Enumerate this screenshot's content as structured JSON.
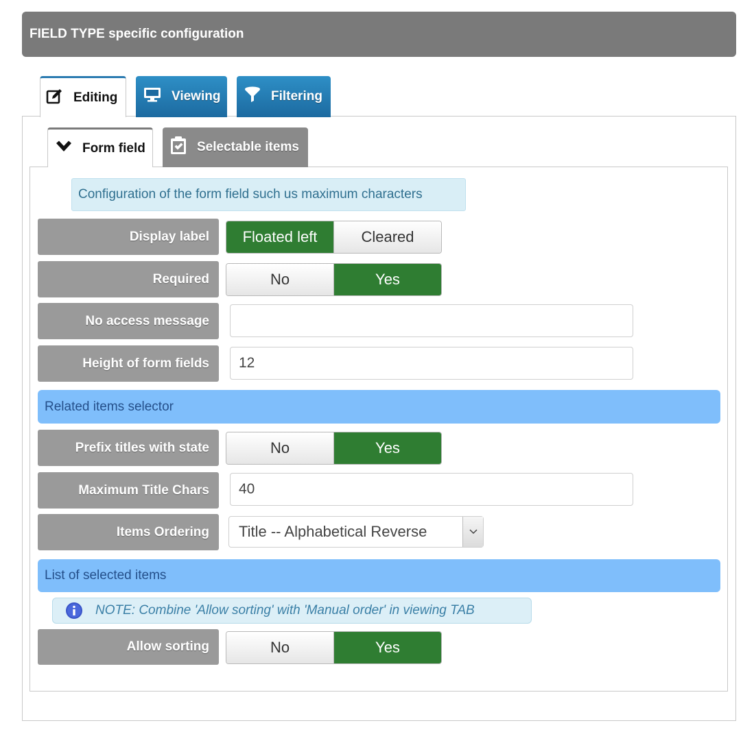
{
  "header": {
    "title": "FIELD TYPE specific configuration"
  },
  "tabs": [
    {
      "label": "Editing",
      "icon": "edit-icon",
      "active": true
    },
    {
      "label": "Viewing",
      "icon": "monitor-icon",
      "active": false
    },
    {
      "label": "Filtering",
      "icon": "filter-icon",
      "active": false
    }
  ],
  "subtabs": [
    {
      "label": "Form field",
      "icon": "chevron-down-icon",
      "active": true
    },
    {
      "label": "Selectable items",
      "icon": "clipboard-check-icon",
      "active": false
    }
  ],
  "info": {
    "text": "Configuration of the form field such us maximum characters"
  },
  "form": {
    "display_label": {
      "label": "Display label",
      "options": [
        "Floated left",
        "Cleared"
      ],
      "selected": "Floated left"
    },
    "required": {
      "label": "Required",
      "options": [
        "No",
        "Yes"
      ],
      "selected": "Yes"
    },
    "no_access_message": {
      "label": "No access message",
      "value": ""
    },
    "height_of_form_fields": {
      "label": "Height of form fields",
      "value": "12"
    }
  },
  "section_related": {
    "title": "Related items selector"
  },
  "related": {
    "prefix_titles": {
      "label": "Prefix titles with state",
      "options": [
        "No",
        "Yes"
      ],
      "selected": "Yes"
    },
    "max_title_chars": {
      "label": "Maximum Title Chars",
      "value": "40"
    },
    "items_ordering": {
      "label": "Items Ordering",
      "selected": "Title -- Alphabetical Reverse"
    }
  },
  "section_selected": {
    "title": "List of selected items"
  },
  "note": {
    "text": "NOTE: Combine 'Allow sorting' with 'Manual order' in viewing TAB"
  },
  "selected": {
    "allow_sorting": {
      "label": "Allow sorting",
      "options": [
        "No",
        "Yes"
      ],
      "selected": "Yes"
    }
  },
  "colors": {
    "header_bg": "#7a7a7a",
    "tab_blue": "#2380b9",
    "toggle_on": "#2f7d32",
    "section_bg": "#7fbefb",
    "label_bg": "#9a9a9a"
  }
}
